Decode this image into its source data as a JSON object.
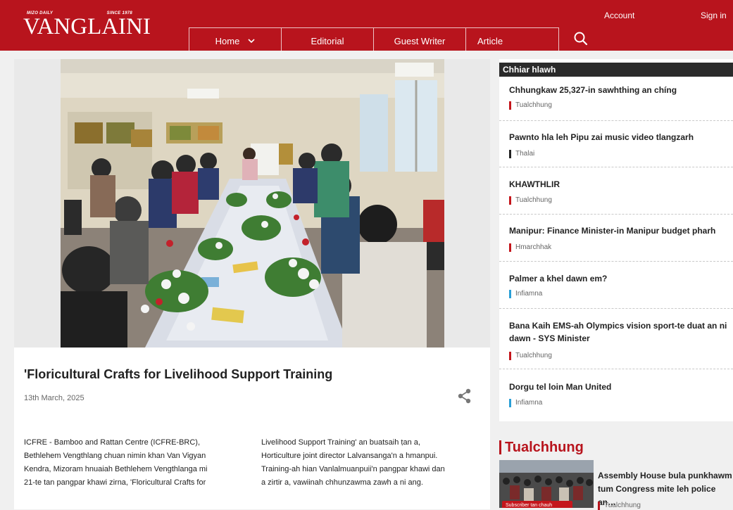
{
  "header": {
    "logo_word": "VANGLAINI",
    "logo_tag_left": "MIZO DAILY",
    "logo_tag_right": "SINCE 1978",
    "account": "Account",
    "sign_in": "Sign in",
    "brand_color": "#b8141d"
  },
  "nav": {
    "home": "Home",
    "editorial": "Editorial",
    "guest_writer": "Guest Writer",
    "article": "Article"
  },
  "article": {
    "title": "'Floricultural Crafts for Livelihood Support Training",
    "date": "13th March, 2025",
    "body_col1": [
      "ICFRE - Bamboo and Rattan Centre (ICFRE-BRC),",
      "Bethlehem Vengthlang chuan nimin khan Van Vigyan",
      "Kendra, Mizoram hnuaiah Bethlehem Vengthlanga mi",
      "21-te tan pangpar khawi zirna, 'Floricultural Crafts for"
    ],
    "body_col2": [
      "Livelihood Support Training' an buatsaih ṭan a,",
      "Horticulture joint director Lalvansanga'n a hmanpui.",
      "Training-ah hian Vanlalmuanpuii'n pangpar khawi dan",
      "a zirtir a, vawiinah chhunzawma zawh a ni ang."
    ]
  },
  "sidebar": {
    "heading": "Chhiar hlawh",
    "items": [
      {
        "title": "Chhungkaw 25,327-in sawhthing an chíng",
        "category": "Tualchhung",
        "color": "#c4161c"
      },
      {
        "title": "Pawnto hla leh Pipu zai music video tlangzarh",
        "category": "Thalai",
        "color": "#222222"
      },
      {
        "title": "KHAWTHLIR",
        "category": "Tualchhung",
        "color": "#c4161c"
      },
      {
        "title": "Manipur: Finance Minister-in Manipur budget pharh",
        "category": "Hmarchhak",
        "color": "#c4161c"
      },
      {
        "title": "Palmer a khel dawn em?",
        "category": "Infiamna",
        "color": "#2a9fd6"
      },
      {
        "title": "Bana Kaih EMS-ah Olympics vision sport-te duat an ni dawn - SYS Minister",
        "category": "Tualchhung",
        "color": "#c4161c"
      },
      {
        "title": "Dorgu tel loin Man United",
        "category": "Infiamna",
        "color": "#2a9fd6"
      }
    ]
  },
  "tualchhung": {
    "heading": "Tualchhung",
    "featured_title": "Assembly House bula punkhawm tum Congress mite leh police an…",
    "featured_category": "Tualchhung",
    "thumb_badge": "Subscriber tan chauh"
  }
}
